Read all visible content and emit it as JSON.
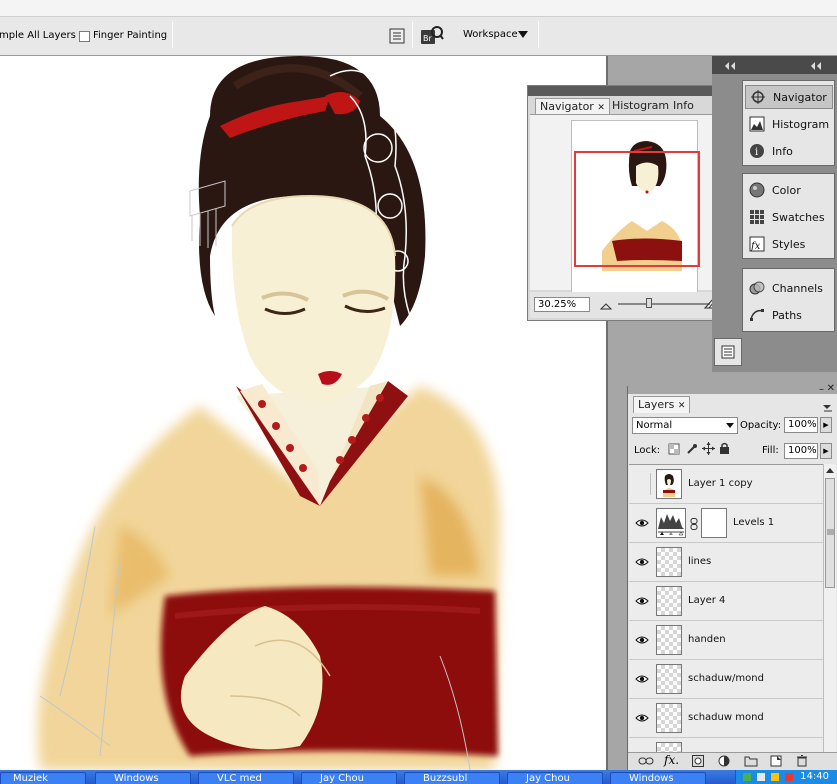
{
  "options_bar": {
    "sample_all_layers": "mple All Layers",
    "finger_painting": "Finger Painting",
    "workspace": "Workspace"
  },
  "navigator": {
    "tabs": [
      "Navigator",
      "Histogram",
      "Info"
    ],
    "zoom": "30.25%"
  },
  "dock": {
    "group1": [
      "Navigator",
      "Histogram",
      "Info"
    ],
    "group2": [
      "Color",
      "Swatches",
      "Styles"
    ],
    "group3": [
      "Channels",
      "Paths"
    ]
  },
  "layers_panel": {
    "tab": "Layers",
    "blend_mode": "Normal",
    "opacity_label": "Opacity:",
    "opacity": "100%",
    "lock_label": "Lock:",
    "fill_label": "Fill:",
    "fill": "100%",
    "layers": [
      {
        "name": "Layer 1 copy",
        "visible": false
      },
      {
        "name": "Levels 1",
        "visible": true
      },
      {
        "name": "lines",
        "visible": true
      },
      {
        "name": "Layer 4",
        "visible": true
      },
      {
        "name": "handen",
        "visible": true
      },
      {
        "name": "schaduw/mond",
        "visible": true
      },
      {
        "name": "schaduw mond",
        "visible": true
      }
    ]
  },
  "taskbar": {
    "items": [
      "Muziek",
      "Windows",
      "VLC med",
      "Jay Chou",
      "Buzzsubl",
      "Jay Chou",
      "Windows"
    ],
    "clock": "14:40"
  }
}
